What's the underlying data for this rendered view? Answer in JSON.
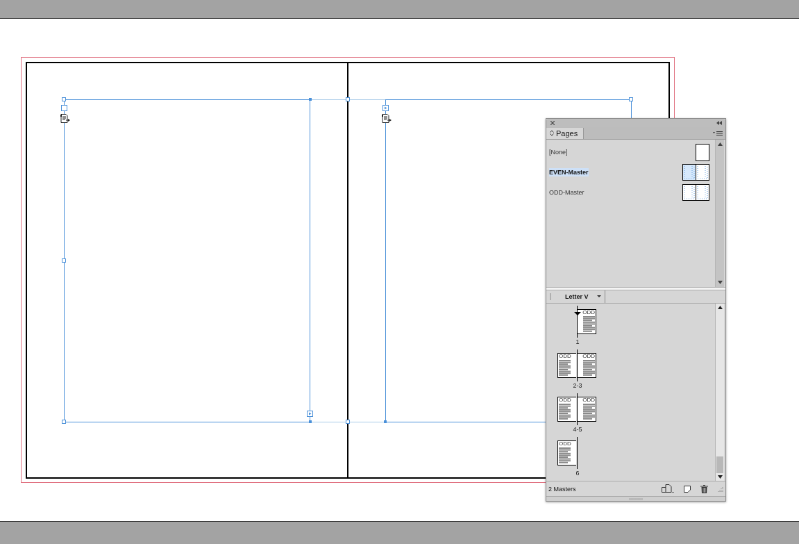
{
  "panel": {
    "title": "Pages",
    "masters": [
      {
        "label": "[None]",
        "kind": "single",
        "selected": false
      },
      {
        "label": "EVEN-Master",
        "kind": "spread",
        "selected": true
      },
      {
        "label": "ODD-Master",
        "kind": "spread",
        "selected": false
      }
    ],
    "page_size": "Letter V",
    "spreads": [
      {
        "label": "1",
        "kind": "right",
        "current": true,
        "pages": [
          {
            "master": "ODD"
          }
        ]
      },
      {
        "label": "2-3",
        "kind": "facing",
        "current": false,
        "pages": [
          {
            "master": "ODD"
          },
          {
            "master": "ODD"
          }
        ]
      },
      {
        "label": "4-5",
        "kind": "facing",
        "current": false,
        "pages": [
          {
            "master": "ODD"
          },
          {
            "master": "ODD"
          }
        ]
      },
      {
        "label": "6",
        "kind": "left",
        "current": false,
        "pages": [
          {
            "master": "ODD"
          }
        ]
      }
    ],
    "status": "2 Masters"
  }
}
